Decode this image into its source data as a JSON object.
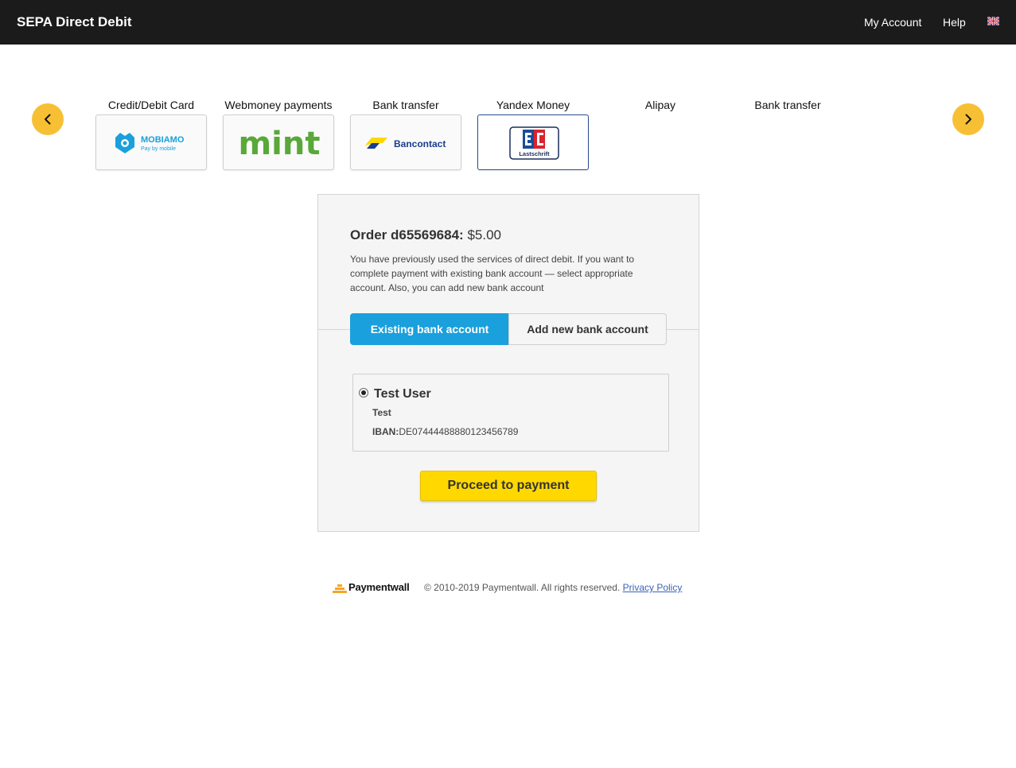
{
  "header": {
    "title": "SEPA Direct Debit",
    "my_account": "My Account",
    "help": "Help",
    "language_icon": "uk-flag-icon"
  },
  "carousel": {
    "prev_icon": "chevron-left-icon",
    "next_icon": "chevron-right-icon",
    "methods": [
      {
        "label": "Credit/Debit Card",
        "logo": "MOBIAMO",
        "logo_sub": "Pay by mobile"
      },
      {
        "label": "Webmoney payments",
        "logo": "mint"
      },
      {
        "label": "Bank transfer",
        "logo": "Bancontact"
      },
      {
        "label": "Yandex Money",
        "logo": "Lastschrift",
        "selected": true
      },
      {
        "label": "Alipay"
      },
      {
        "label": "Bank transfer"
      }
    ]
  },
  "order": {
    "label": "Order d65569684:",
    "amount": "$5.00",
    "notice": "You have previously used the services of direct debit. If you want to complete payment with existing bank account — select appropriate account. Also, you can add new bank account"
  },
  "tabs": {
    "existing": "Existing bank account",
    "new": "Add new bank account"
  },
  "account": {
    "name": "Test User",
    "bank": "Test",
    "iban_label": "IBAN:",
    "iban": "DE07444488880123456789"
  },
  "proceed_label": "Proceed to payment",
  "footer": {
    "brand": "Paymentwall",
    "copyright": "© 2010-2019 Paymentwall. All rights reserved.",
    "privacy": "Privacy Policy"
  },
  "colors": {
    "topbar": "#1b1b1b",
    "accent_blue": "#1aa0dc",
    "proceed_yellow": "#ffd800",
    "arrow_yellow": "#f7c034"
  }
}
